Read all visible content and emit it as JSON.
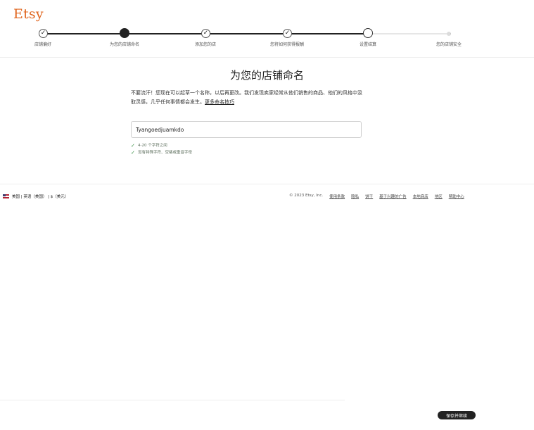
{
  "brand": {
    "logo_text": "Etsy",
    "color": "#e0651e"
  },
  "steps": [
    {
      "label": "店铺偏好",
      "state": "done"
    },
    {
      "label": "为您的店铺命名",
      "state": "current"
    },
    {
      "label": "添加您的店",
      "state": "done"
    },
    {
      "label": "您将如何获得报酬",
      "state": "done"
    },
    {
      "label": "设置结算",
      "state": "open"
    },
    {
      "label": "您的店铺安全",
      "state": "future"
    }
  ],
  "main": {
    "title": "为您的店铺命名",
    "description": "不要流汗！您现在可以起草一个名称，以后再更改。我们发现卖家经常从他们销售的商品、他们的风格中汲取灵感，几乎任何事情都会发生。",
    "tips_link": "更多命名技巧",
    "shop_name_value": "Tyangoedjuamkdo",
    "rules": [
      "4-20 个字符之间",
      "没有特殊字符、空格或重音字母"
    ]
  },
  "footer": {
    "locale": "美国 | 英语（美国） | $（美元）",
    "copyright": "© 2023 Etsy, Inc.",
    "links": [
      "使用条款",
      "隐私",
      "饼干",
      "基于兴趣的广告",
      "本地商店",
      "地区",
      "帮助中心"
    ]
  },
  "actions": {
    "save_label": "保存并继续"
  },
  "icons": {
    "check": "check-icon",
    "flag": "us-flag-icon"
  }
}
